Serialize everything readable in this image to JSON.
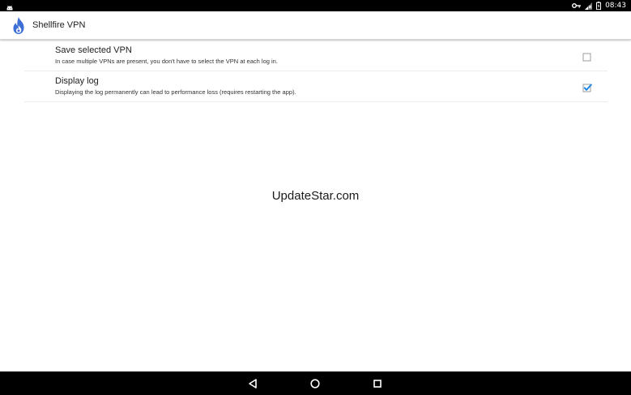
{
  "status_bar": {
    "time": "08:43",
    "icons": [
      "android-notification-icon",
      "key-icon",
      "signal-icon",
      "battery-icon"
    ]
  },
  "app_bar": {
    "title": "Shellfire VPN",
    "logo_icon": "shellfire-flame-logo",
    "accent_color": "#3d6fd6"
  },
  "settings": [
    {
      "title": "Save selected VPN",
      "summary": "In case multiple VPNs are present, you don't have to select the VPN at each log in.",
      "checked": false
    },
    {
      "title": "Display log",
      "summary": "Displaying the log permanently can lead to performance loss (requires restarting the app).",
      "checked": true
    }
  ],
  "watermark": "UpdateStar.com",
  "nav_bar": {
    "buttons": [
      "back-icon",
      "home-icon",
      "recents-icon"
    ]
  },
  "colors": {
    "checkbox_checked": "#1e88e5",
    "checkbox_unchecked_border": "#9e9e9e"
  }
}
